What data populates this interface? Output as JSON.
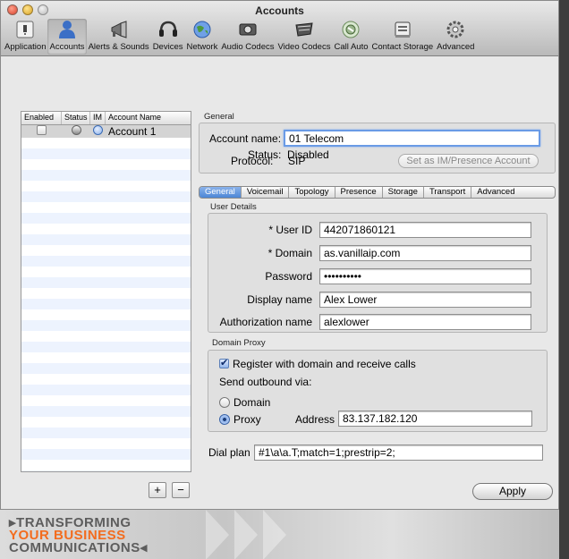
{
  "window": {
    "title": "Accounts"
  },
  "toolbar": {
    "items": [
      {
        "label": "Application",
        "icon": "application-switch-icon"
      },
      {
        "label": "Accounts",
        "icon": "person-icon"
      },
      {
        "label": "Alerts & Sounds",
        "icon": "megaphone-icon"
      },
      {
        "label": "Devices",
        "icon": "headset-icon"
      },
      {
        "label": "Network",
        "icon": "network-globe-icon"
      },
      {
        "label": "Audio Codecs",
        "icon": "audio-codecs-icon"
      },
      {
        "label": "Video Codecs",
        "icon": "video-codecs-icon"
      },
      {
        "label": "Call Auto",
        "icon": "call-auto-icon"
      },
      {
        "label": "Contact Storage",
        "icon": "contact-storage-icon"
      },
      {
        "label": "Advanced",
        "icon": "gear-icon"
      }
    ],
    "selected": "Accounts"
  },
  "accounts_table": {
    "columns": [
      "Enabled",
      "Status",
      "IM",
      "Account Name"
    ],
    "rows": [
      {
        "enabled": false,
        "account_name": "Account 1"
      }
    ]
  },
  "list_buttons": {
    "add": "+",
    "remove": "−"
  },
  "general": {
    "section_title": "General",
    "account_name_label": "Account name:",
    "account_name": "01 Telecom",
    "protocol_label": "Protocol:",
    "protocol": "SIP",
    "im_button": "Set as IM/Presence Account",
    "status_label": "Status:",
    "status": "Disabled"
  },
  "tabs": [
    "General",
    "Voicemail",
    "Topology",
    "Presence",
    "Storage",
    "Transport",
    "Advanced"
  ],
  "active_tab": "General",
  "user_details": {
    "section_title": "User Details",
    "user_id_label": "* User ID",
    "user_id": "442071860121",
    "domain_label": "* Domain",
    "domain": "as.vanillaip.com",
    "password_label": "Password",
    "password": "••••••••••",
    "display_name_label": "Display name",
    "display_name": "Alex Lower",
    "auth_name_label": "Authorization name",
    "auth_name": "alexlower"
  },
  "domain_proxy": {
    "section_title": "Domain Proxy",
    "register_label": "Register with domain and receive calls",
    "register_checked": true,
    "send_outbound_label": "Send outbound via:",
    "domain_option": "Domain",
    "proxy_option": "Proxy",
    "selected_option": "Proxy",
    "address_label": "Address",
    "address": "83.137.182.120"
  },
  "dial_plan": {
    "label": "Dial plan",
    "value": "#1\\a\\a.T;match=1;prestrip=2;"
  },
  "apply_button": "Apply",
  "banner": {
    "line1": "▸TRANSFORMING",
    "line2": "YOUR BUSINESS",
    "line3": "COMMUNICATIONS◂"
  },
  "colors": {
    "accent": "#4c86d6",
    "banner_orange": "#f36c1e",
    "banner_gray": "#5d5d5d"
  }
}
